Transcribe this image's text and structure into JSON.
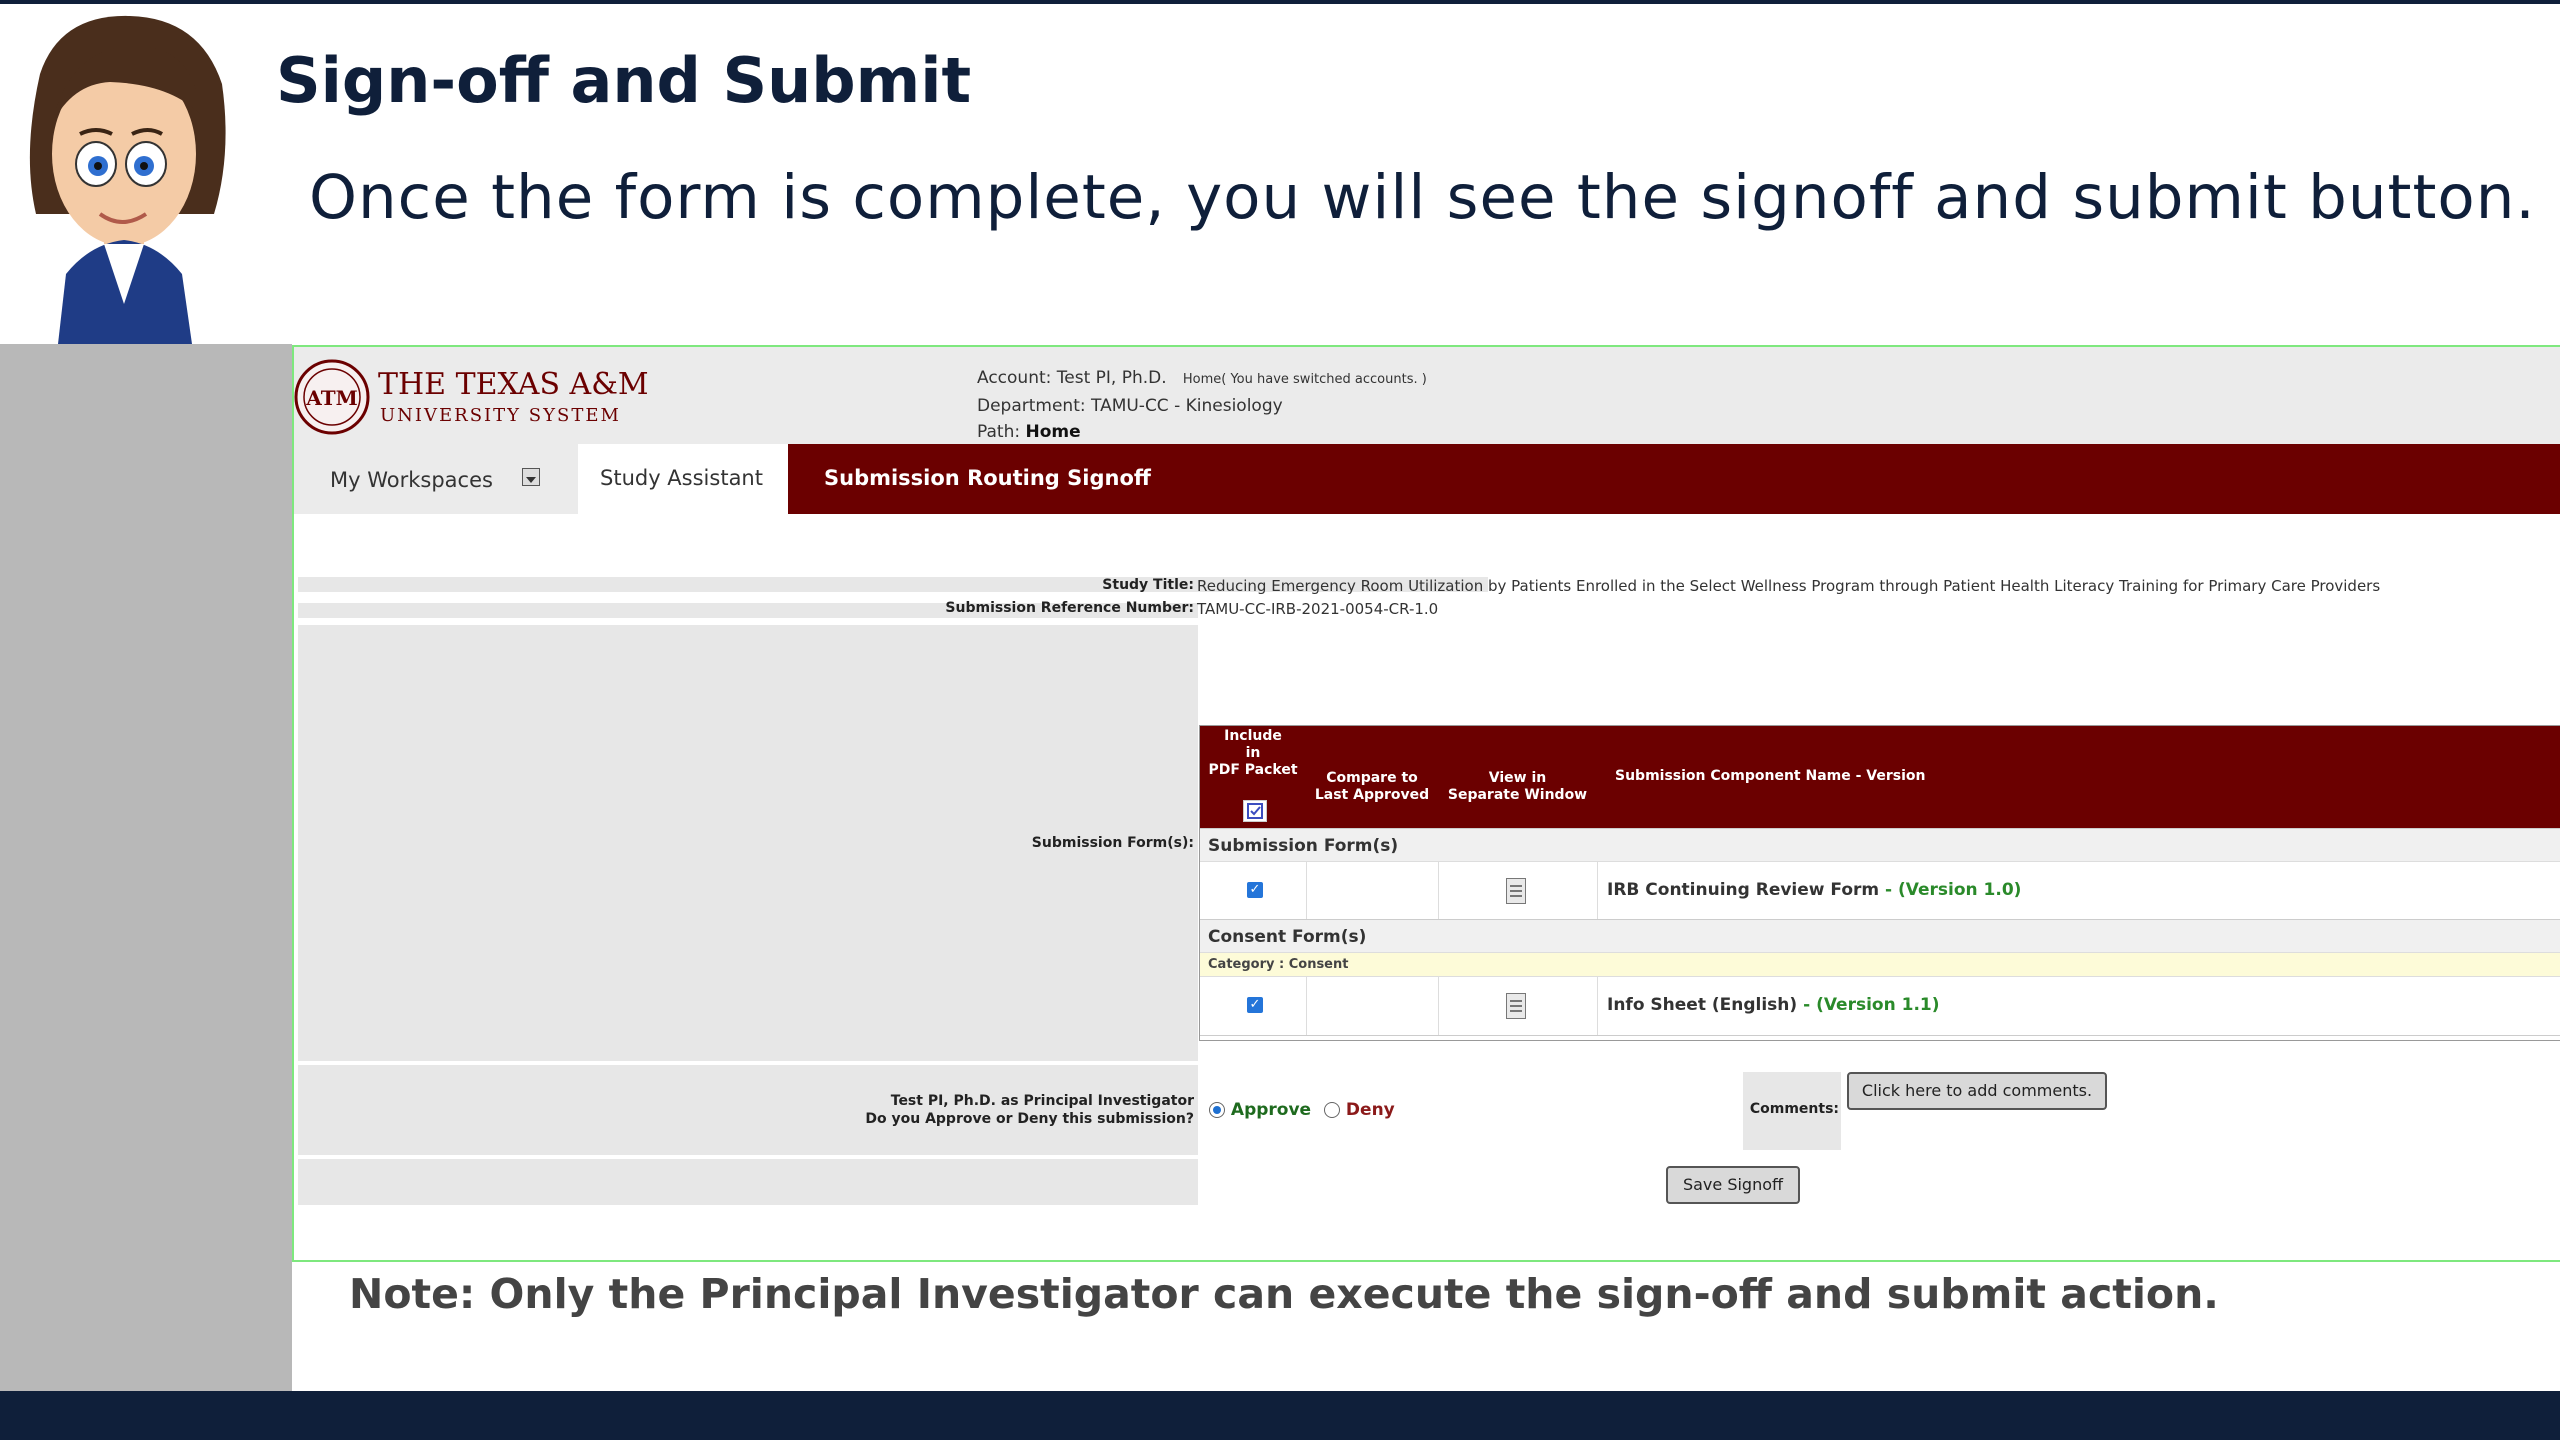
{
  "slide": {
    "title": "Sign-off and Submit",
    "body": "Once the form is complete, you will see the signoff and submit button.",
    "note": "Note: Only the Principal Investigator can execute the sign-off and submit action."
  },
  "colors": {
    "navy": "#0f1f3a",
    "maroon": "#6b0000",
    "frame_green": "#7ee87e",
    "version_green": "#2a8a2a"
  },
  "app": {
    "logo": {
      "line1": "THE TEXAS A&M",
      "line2": "UNIVERSITY SYSTEM",
      "seal_text": "ATM"
    },
    "account": {
      "account_label": "Account: Test PI, Ph.D.",
      "account_note": "Home( You have switched accounts. )",
      "department": "Department:  TAMU-CC - Kinesiology",
      "path_label": "Path:",
      "path_value": "Home"
    },
    "tabs": {
      "my_workspaces": "My Workspaces",
      "study_assistant": "Study Assistant",
      "submission_routing": "Submission Routing Signoff"
    },
    "study": {
      "title_label": "Study Title:",
      "title_value": "Reducing Emergency Room Utilization by Patients Enrolled in the Select Wellness Program through Patient Health Literacy Training for Primary Care Providers",
      "ref_label": "Submission Reference Number:",
      "ref_value": "TAMU-CC-IRB-2021-0054-CR-1.0"
    },
    "forms_label": "Submission Form(s):",
    "table": {
      "headers": {
        "include_l1": "Include",
        "include_l2": "in",
        "include_l3": "PDF Packet",
        "compare_l1": "Compare to",
        "compare_l2": "Last Approved",
        "view_l1": "View in",
        "view_l2": "Separate Window",
        "component": "Submission Component Name - Version"
      },
      "section_forms": "Submission Form(s)",
      "row1": {
        "name": "IRB Continuing Review Form",
        "version": " - (Version 1.0)"
      },
      "section_consent": "Consent Form(s)",
      "category": "Category : Consent",
      "row2": {
        "name": "Info Sheet (English)",
        "version": " - (Version 1.1)"
      }
    },
    "signoff": {
      "question_l1": "Test PI, Ph.D.  as Principal Investigator",
      "question_l2": "Do you Approve or Deny this submission?",
      "approve": "Approve",
      "deny": "Deny",
      "comments_label": "Comments:",
      "comments_button": "Click here to add comments.",
      "save_button": "Save Signoff"
    }
  }
}
